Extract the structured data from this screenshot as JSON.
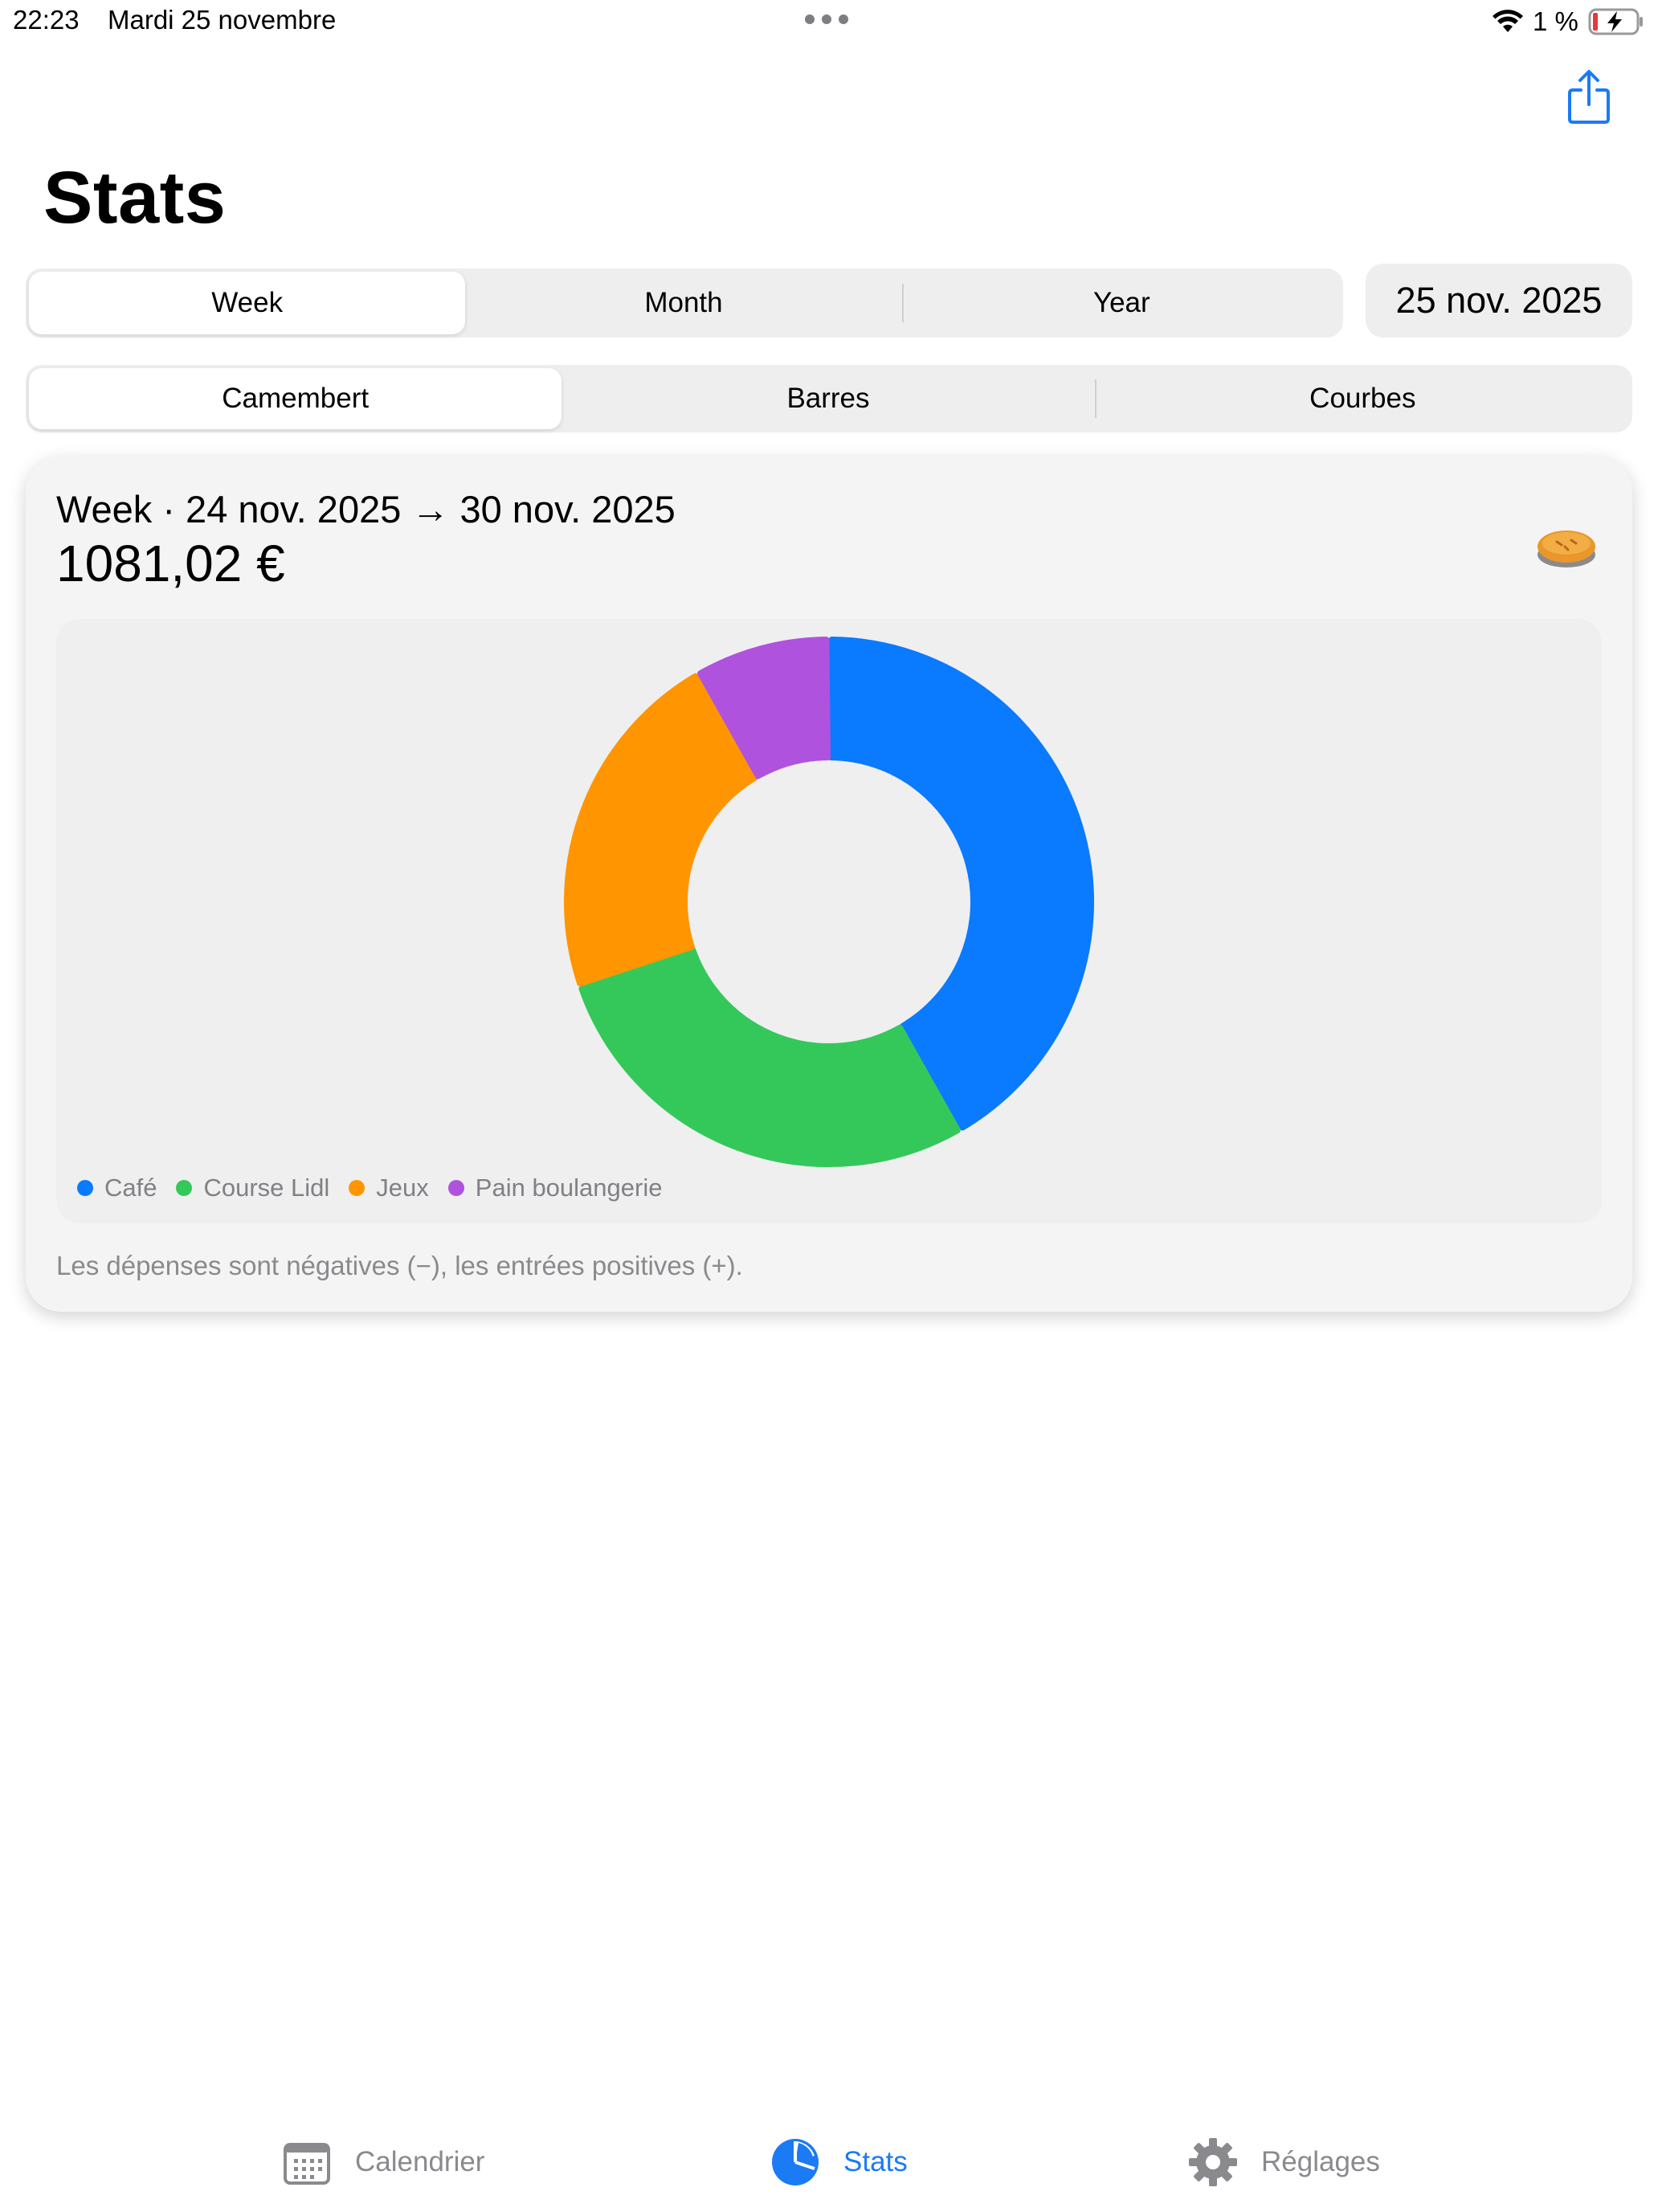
{
  "status_bar": {
    "time": "22:23",
    "date": "Mardi 25 novembre",
    "battery": "1 %"
  },
  "header": {
    "title": "Stats",
    "share_icon": "share-icon"
  },
  "period_segment": {
    "items": [
      "Week",
      "Month",
      "Year"
    ],
    "selected": "Week"
  },
  "date_picker": {
    "value": "25 nov. 2025"
  },
  "chart_segment": {
    "items": [
      "Camembert",
      "Barres",
      "Courbes"
    ],
    "selected": "Camembert"
  },
  "card": {
    "period": "Week · 24 nov. 2025 → 30 nov. 2025",
    "total": "1081,02 €",
    "icon": "pie-emoji-icon",
    "footnote": "Les dépenses sont négatives (−), les entrées positives (+)."
  },
  "colors": {
    "accent": "#1a7bf5",
    "cafe": "#0a7aff",
    "course_lidl": "#34c85a",
    "jeux": "#ff9500",
    "pain_boulangerie": "#af52de"
  },
  "chart_data": {
    "type": "pie",
    "style": "donut",
    "categories": [
      "Café",
      "Course Lidl",
      "Jeux",
      "Pain boulangerie"
    ],
    "values": [
      40,
      27,
      21,
      8
    ],
    "colors": [
      "#0a7aff",
      "#34c85a",
      "#ff9500",
      "#af52de"
    ],
    "legend_position": "bottom-left"
  },
  "tabbar": {
    "items": [
      {
        "label": "Calendrier",
        "icon": "calendar-icon",
        "active": false
      },
      {
        "label": "Stats",
        "icon": "pie-chart-icon",
        "active": true
      },
      {
        "label": "Réglages",
        "icon": "gear-icon",
        "active": false
      }
    ]
  }
}
